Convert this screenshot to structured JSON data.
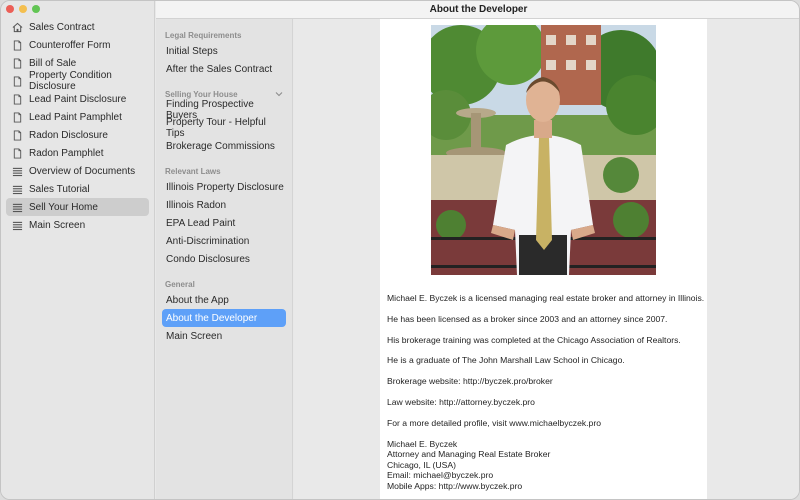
{
  "window": {
    "title": "About the Developer"
  },
  "sidebar1": {
    "items": [
      {
        "label": "Sales Contract",
        "icon": "house-icon",
        "selected": false
      },
      {
        "label": "Counteroffer Form",
        "icon": "document-icon",
        "selected": false
      },
      {
        "label": "Bill of Sale",
        "icon": "document-icon",
        "selected": false
      },
      {
        "label": "Property Condition Disclosure",
        "icon": "document-icon",
        "selected": false
      },
      {
        "label": "Lead Paint Disclosure",
        "icon": "document-icon",
        "selected": false
      },
      {
        "label": "Lead Paint Pamphlet",
        "icon": "document-icon",
        "selected": false
      },
      {
        "label": "Radon Disclosure",
        "icon": "document-icon",
        "selected": false
      },
      {
        "label": "Radon Pamphlet",
        "icon": "document-icon",
        "selected": false
      },
      {
        "label": "Overview of Documents",
        "icon": "list-icon",
        "selected": false
      },
      {
        "label": "Sales Tutorial",
        "icon": "list-icon",
        "selected": false
      },
      {
        "label": "Sell Your Home",
        "icon": "list-icon",
        "selected": true
      },
      {
        "label": "Main Screen",
        "icon": "list-icon",
        "selected": false
      }
    ]
  },
  "sidebar2": {
    "sections": [
      {
        "title": "Legal Requirements",
        "collapsible": false,
        "items": [
          "Initial Steps",
          "After the Sales Contract"
        ]
      },
      {
        "title": "Selling Your House",
        "collapsible": true,
        "items": [
          "Finding Prospective Buyers",
          "Property Tour - Helpful Tips",
          "Brokerage Commissions"
        ]
      },
      {
        "title": "Relevant Laws",
        "collapsible": false,
        "items": [
          "Illinois Property Disclosure",
          "Illinois Radon",
          "EPA Lead Paint",
          "Anti-Discrimination",
          "Condo Disclosures"
        ]
      },
      {
        "title": "General",
        "collapsible": false,
        "items": [
          "About the App",
          "About the Developer",
          "Main Screen"
        ]
      }
    ],
    "selected": "About the Developer"
  },
  "content": {
    "paragraphs": [
      "Michael E. Byczek is a licensed managing real estate broker and attorney in Illinois.",
      "He has been licensed as a broker since 2003 and an attorney since 2007.",
      "His brokerage training was completed at the Chicago Association of Realtors.",
      "He is a graduate of The John Marshall Law School in Chicago.",
      "Brokerage website: http://byczek.pro/broker",
      "Law website: http://attorney.byczek.pro",
      "For a more detailed profile, visit www.michaelbyczek.pro"
    ],
    "signature": [
      "Michael E. Byczek",
      "Attorney and Managing Real Estate Broker",
      "Chicago, IL (USA)",
      "Email: michael@byczek.pro",
      "Mobile Apps: http://www.byczek.pro"
    ]
  },
  "colors": {
    "accent": "#5ea0f8",
    "selected_gray": "#cdcdcd"
  }
}
